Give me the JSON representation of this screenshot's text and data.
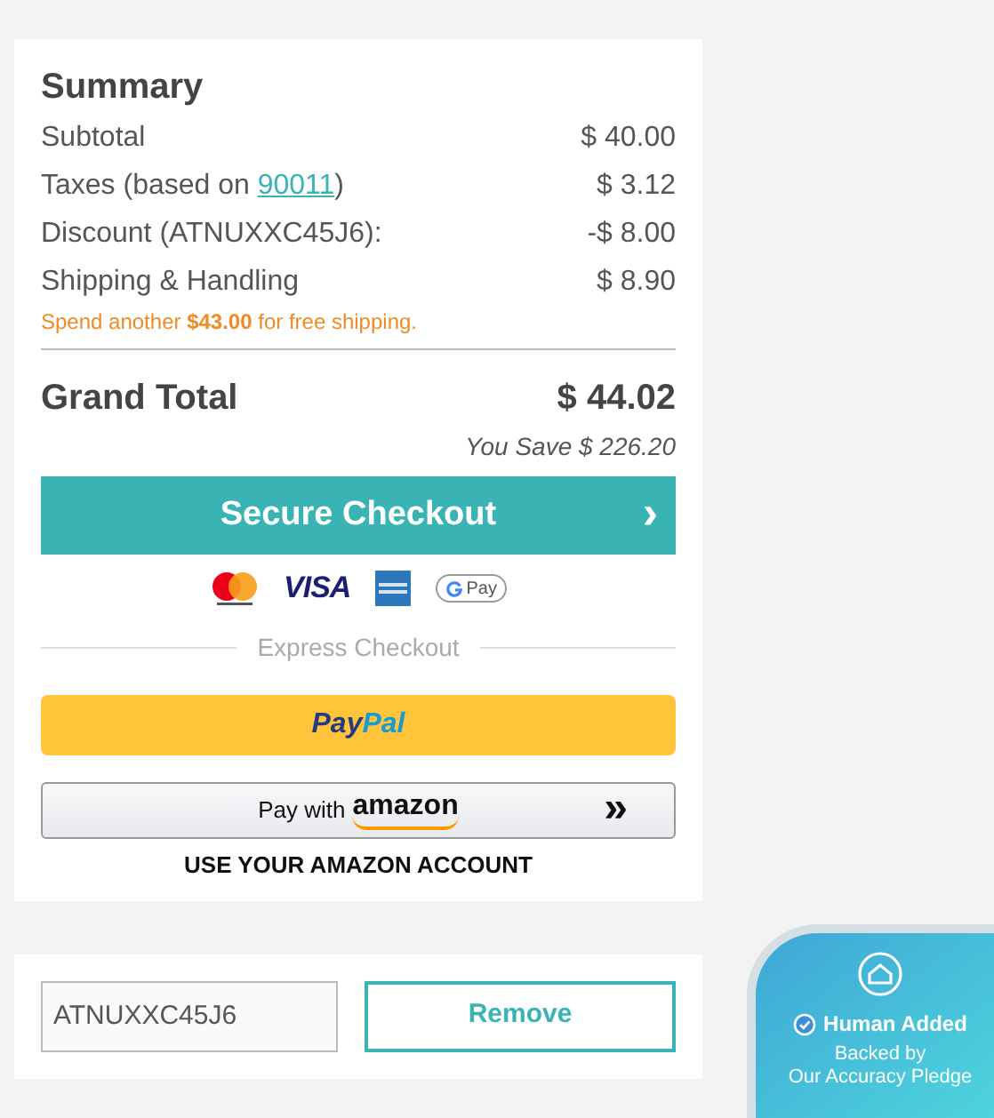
{
  "summary": {
    "title": "Summary",
    "lines": [
      {
        "label": "Subtotal",
        "value": "$ 40.00"
      },
      {
        "label": "Taxes (based on ",
        "link": "90011",
        "label_end": ")",
        "value": "$ 3.12"
      },
      {
        "label": "Discount (ATNUXXC45J6):",
        "value": "-$ 8.00"
      },
      {
        "label": "Shipping & Handling",
        "value": "$ 8.90"
      }
    ],
    "shipping_note": "Spend another **$43.00** for free shipping.",
    "grand_total": {
      "label": "Grand Total",
      "value": "$ 44.02"
    },
    "savings": "You Save $ 226.20",
    "checkout_button": {
      "label": "Secure Checkout",
      "chevron": "›"
    },
    "payment_logos": [
      {
        "kind": "mastercard"
      },
      {
        "kind": "visa",
        "text": "VISA"
      },
      {
        "kind": "amex"
      },
      {
        "kind": "gpay",
        "text": "Pay"
      }
    ],
    "express_label": "Express Checkout",
    "paypal_button": {
      "text_a": "Pay",
      "text_b": "Pal"
    },
    "amazon_button": {
      "prefix": "Pay with",
      "brand": "amazon",
      "chevron": "»"
    },
    "amazon_note": "USE YOUR AMAZON ACCOUNT"
  },
  "coupon": {
    "value": "ATNUXXC45J6",
    "button": "Remove"
  },
  "badge": {
    "title": "Human Added",
    "subtitle_1": "Backed by",
    "subtitle_2": "Our Accuracy Pledge"
  }
}
